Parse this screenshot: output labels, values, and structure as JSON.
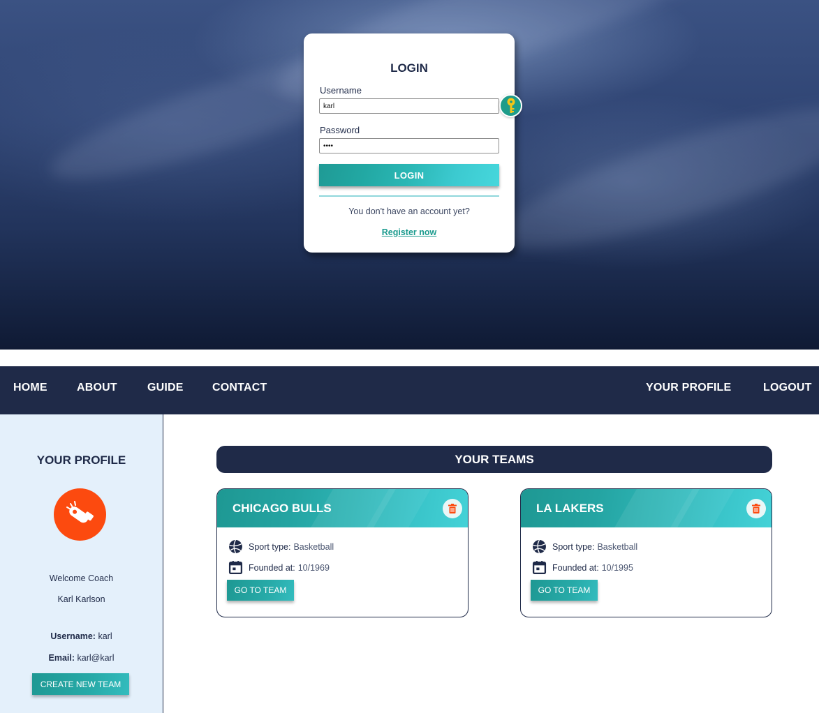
{
  "login": {
    "title": "LOGIN",
    "username_label": "Username",
    "username_value": "karl",
    "password_label": "Password",
    "password_value": "••••",
    "button_label": "LOGIN",
    "no_account_text": "You don't have an account yet?",
    "register_link": "Register now",
    "key_icon": "key-icon"
  },
  "nav": {
    "items": [
      "HOME",
      "ABOUT",
      "GUIDE",
      "CONTACT"
    ],
    "right_items": [
      "YOUR PROFILE",
      "LOGOUT"
    ]
  },
  "sidebar": {
    "title": "YOUR PROFILE",
    "avatar_icon": "whistle-icon",
    "avatar_color": "#fc4a0f",
    "welcome": "Welcome Coach",
    "name": "Karl Karlson",
    "username_label": "Username:",
    "username_value": "karl",
    "email_label": "Email:",
    "email_value": "karl@karl",
    "create_button": "CREATE NEW TEAM"
  },
  "main": {
    "teams_header": "YOUR TEAMS",
    "teams": [
      {
        "name": "CHICAGO BULLS",
        "sport_label": "Sport type:",
        "sport_value": "Basketball",
        "founded_label": "Founded at:",
        "founded_value": "10/1969",
        "button": "GO TO TEAM"
      },
      {
        "name": "LA LAKERS",
        "sport_label": "Sport type:",
        "sport_value": "Basketball",
        "founded_label": "Founded at:",
        "founded_value": "10/1995",
        "button": "GO TO TEAM"
      }
    ]
  },
  "colors": {
    "navy": "#1f2a48",
    "teal": "#27aaa8",
    "accent_orange": "#fc4a0f",
    "sidebar_bg": "#e4f0fb"
  }
}
